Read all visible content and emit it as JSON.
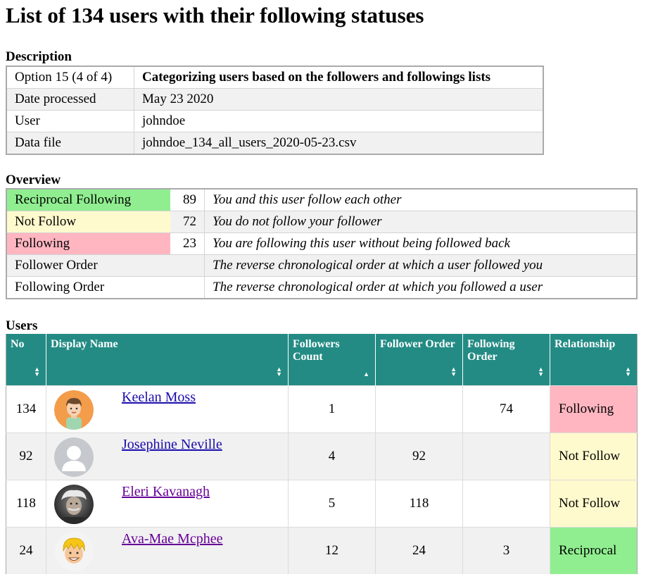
{
  "page_title": "List of 134 users with their following statuses",
  "description": {
    "label": "Description",
    "rows": [
      {
        "key": "Option 15 (4 of 4)",
        "value": "Categorizing users based on the followers and followings lists"
      },
      {
        "key": "Date processed",
        "value": "May 23 2020"
      },
      {
        "key": "User",
        "value": "johndoe"
      },
      {
        "key": "Data file",
        "value": "johndoe_134_all_users_2020-05-23.csv"
      }
    ]
  },
  "overview": {
    "label": "Overview",
    "rows": [
      {
        "name": "Reciprocal Following",
        "count": "89",
        "desc": "You and this user follow each other"
      },
      {
        "name": "Not Follow",
        "count": "72",
        "desc": "You do not follow your follower"
      },
      {
        "name": "Following",
        "count": "23",
        "desc": "You are following this user without being followed back"
      },
      {
        "name": "Follower Order",
        "count": "",
        "desc": "The reverse chronological order at which a user followed you"
      },
      {
        "name": "Following Order",
        "count": "",
        "desc": "The reverse chronological order at which you followed a user"
      }
    ],
    "colors": {
      "reciprocal": "#90ee90",
      "not_follow": "#fffacd",
      "following": "#ffb6c1"
    }
  },
  "users": {
    "label": "Users",
    "header_color": "#238b84",
    "columns": {
      "no": "No",
      "display_name": "Display Name",
      "followers_count": "Followers Count",
      "follower_order": "Follower Order",
      "following_order": "Following Order",
      "relationship": "Relationship"
    },
    "rows": [
      {
        "no": "134",
        "name": "Keelan Moss",
        "avatar": "cartoon-man-avatar",
        "followers": "1",
        "follower_order": "",
        "following_order": "74",
        "relationship": "Following"
      },
      {
        "no": "92",
        "name": "Josephine Neville",
        "avatar": "default-person-avatar",
        "followers": "4",
        "follower_order": "92",
        "following_order": "",
        "relationship": "Not Follow"
      },
      {
        "no": "118",
        "name": "Eleri Kavanagh",
        "avatar": "photo-avatar",
        "followers": "5",
        "follower_order": "118",
        "following_order": "",
        "relationship": "Not Follow"
      },
      {
        "no": "24",
        "name": "Ava-Mae Mcphee",
        "avatar": "cartoon-boy-avatar",
        "followers": "12",
        "follower_order": "24",
        "following_order": "3",
        "relationship": "Reciprocal"
      }
    ]
  }
}
